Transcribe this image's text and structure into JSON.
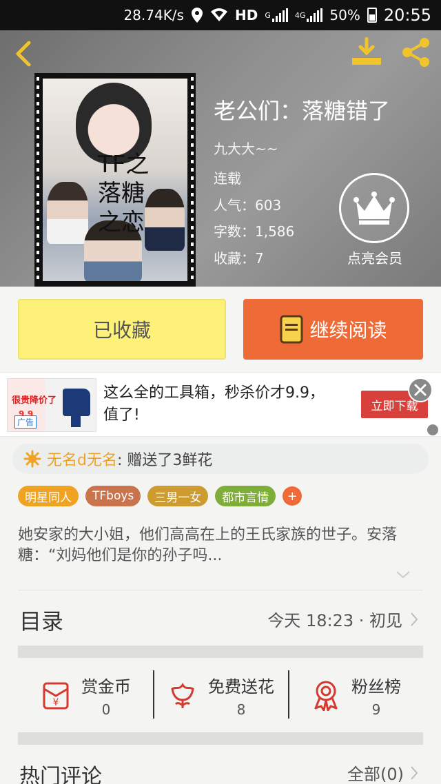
{
  "status_bar": {
    "speed": "28.74K/s",
    "hd": "HD",
    "net_g": "G",
    "net_4g": "4G",
    "battery": "50%",
    "time": "20:55"
  },
  "book": {
    "title": "老公们：落糖错了",
    "author": "九大大~~",
    "status": "连载",
    "popularity": "人气：603",
    "word_count": "字数：1,586",
    "favorites": "收藏：7",
    "cover_text": "TF之落糖之恋"
  },
  "vip": {
    "label": "点亮会员"
  },
  "actions": {
    "favorited_label": "已收藏",
    "continue_label": "继续阅读"
  },
  "ad": {
    "text": "这么全的工具箱，秒杀价才9.9，值了!",
    "button": "立即下载",
    "tag": "广告",
    "thumb_text": "很贵降价了",
    "thumb_price": "9.9"
  },
  "gift": {
    "user": "无名d无名",
    "message": ": 赠送了3鲜花"
  },
  "tags": [
    {
      "label": "明星同人",
      "color": "#f0a323"
    },
    {
      "label": "TFboys",
      "color": "#c9744c"
    },
    {
      "label": "三男一女",
      "color": "#cd9b2f"
    },
    {
      "label": "都市言情",
      "color": "#7fad3a"
    }
  ],
  "tag_add": "+",
  "description": "她安家的大小姐，他们高高在上的王氏家族的世子。安落糖：“刘妈他们是你的孙子吗...",
  "catalog": {
    "title": "目录",
    "update": "今天 18:23 · 初见"
  },
  "stats": [
    {
      "label": "赏金币",
      "count": "0",
      "icon": "red-envelope-icon"
    },
    {
      "label": "免费送花",
      "count": "8",
      "icon": "flower-icon"
    },
    {
      "label": "粉丝榜",
      "count": "9",
      "icon": "medal-icon"
    }
  ],
  "comments": {
    "title": "热门评论",
    "all": "全部(0)"
  },
  "colors": {
    "accent_orange": "#ee6a36",
    "favorite_yellow": "#fdf17a",
    "icon_yellow": "#f2c42b",
    "stat_red": "#d43a2f"
  }
}
